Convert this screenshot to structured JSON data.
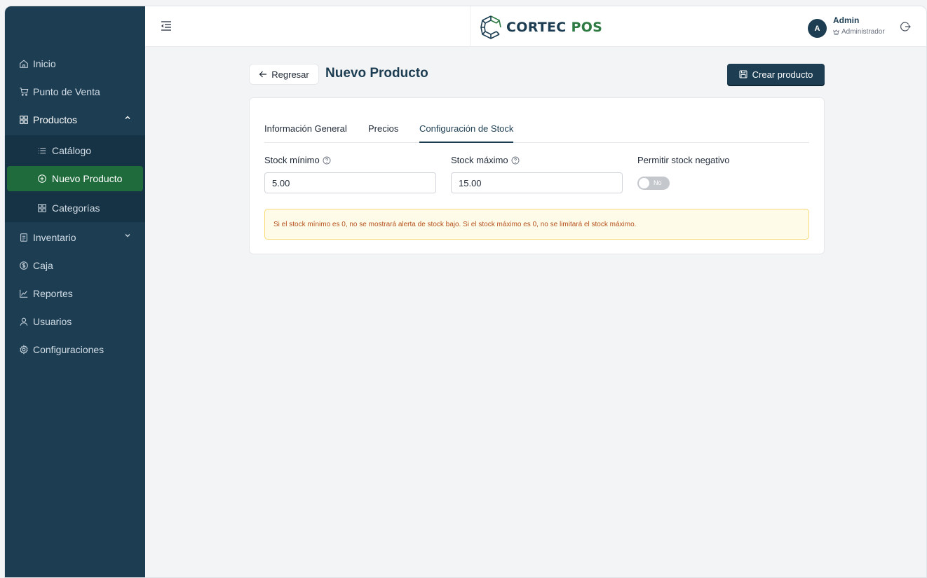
{
  "app": {
    "logo_word1": "CORTEC",
    "logo_word2": "POS",
    "brand_color": "#1c3d52",
    "accent_color": "#1f6b3b"
  },
  "sidebar": {
    "items": [
      {
        "label": "Inicio",
        "icon": "home-icon"
      },
      {
        "label": "Punto de Venta",
        "icon": "cart-icon"
      },
      {
        "label": "Productos",
        "icon": "grid-icon",
        "expanded": true
      },
      {
        "label": "Inventario",
        "icon": "clipboard-icon",
        "expanded": false
      },
      {
        "label": "Caja",
        "icon": "dollar-circle-icon"
      },
      {
        "label": "Reportes",
        "icon": "chart-line-icon"
      },
      {
        "label": "Usuarios",
        "icon": "user-icon"
      },
      {
        "label": "Configuraciones",
        "icon": "gear-icon"
      }
    ],
    "submenu": [
      {
        "label": "Catálogo",
        "icon": "list-icon"
      },
      {
        "label": "Nuevo Producto",
        "icon": "plus-circle-icon",
        "active": true
      },
      {
        "label": "Categorías",
        "icon": "grid-icon"
      }
    ]
  },
  "header": {
    "avatar_initial": "A",
    "user_name": "Admin",
    "user_role": "Administrador"
  },
  "page": {
    "back_label": "Regresar",
    "title": "Nuevo Producto",
    "create_label": "Crear producto"
  },
  "tabs": [
    {
      "label": "Información General",
      "active": false
    },
    {
      "label": "Precios",
      "active": false
    },
    {
      "label": "Configuración de Stock",
      "active": true
    }
  ],
  "form": {
    "stock_min_label": "Stock mínimo",
    "stock_min_value": "5.00",
    "stock_max_label": "Stock máximo",
    "stock_max_value": "15.00",
    "negative_label": "Permitir stock negativo",
    "negative_toggle_text": "No",
    "negative_enabled": false
  },
  "alert": {
    "text": "Si el stock mínimo es 0, no se mostrará alerta de stock bajo. Si el stock máximo es 0, no se limitará el stock máximo."
  }
}
